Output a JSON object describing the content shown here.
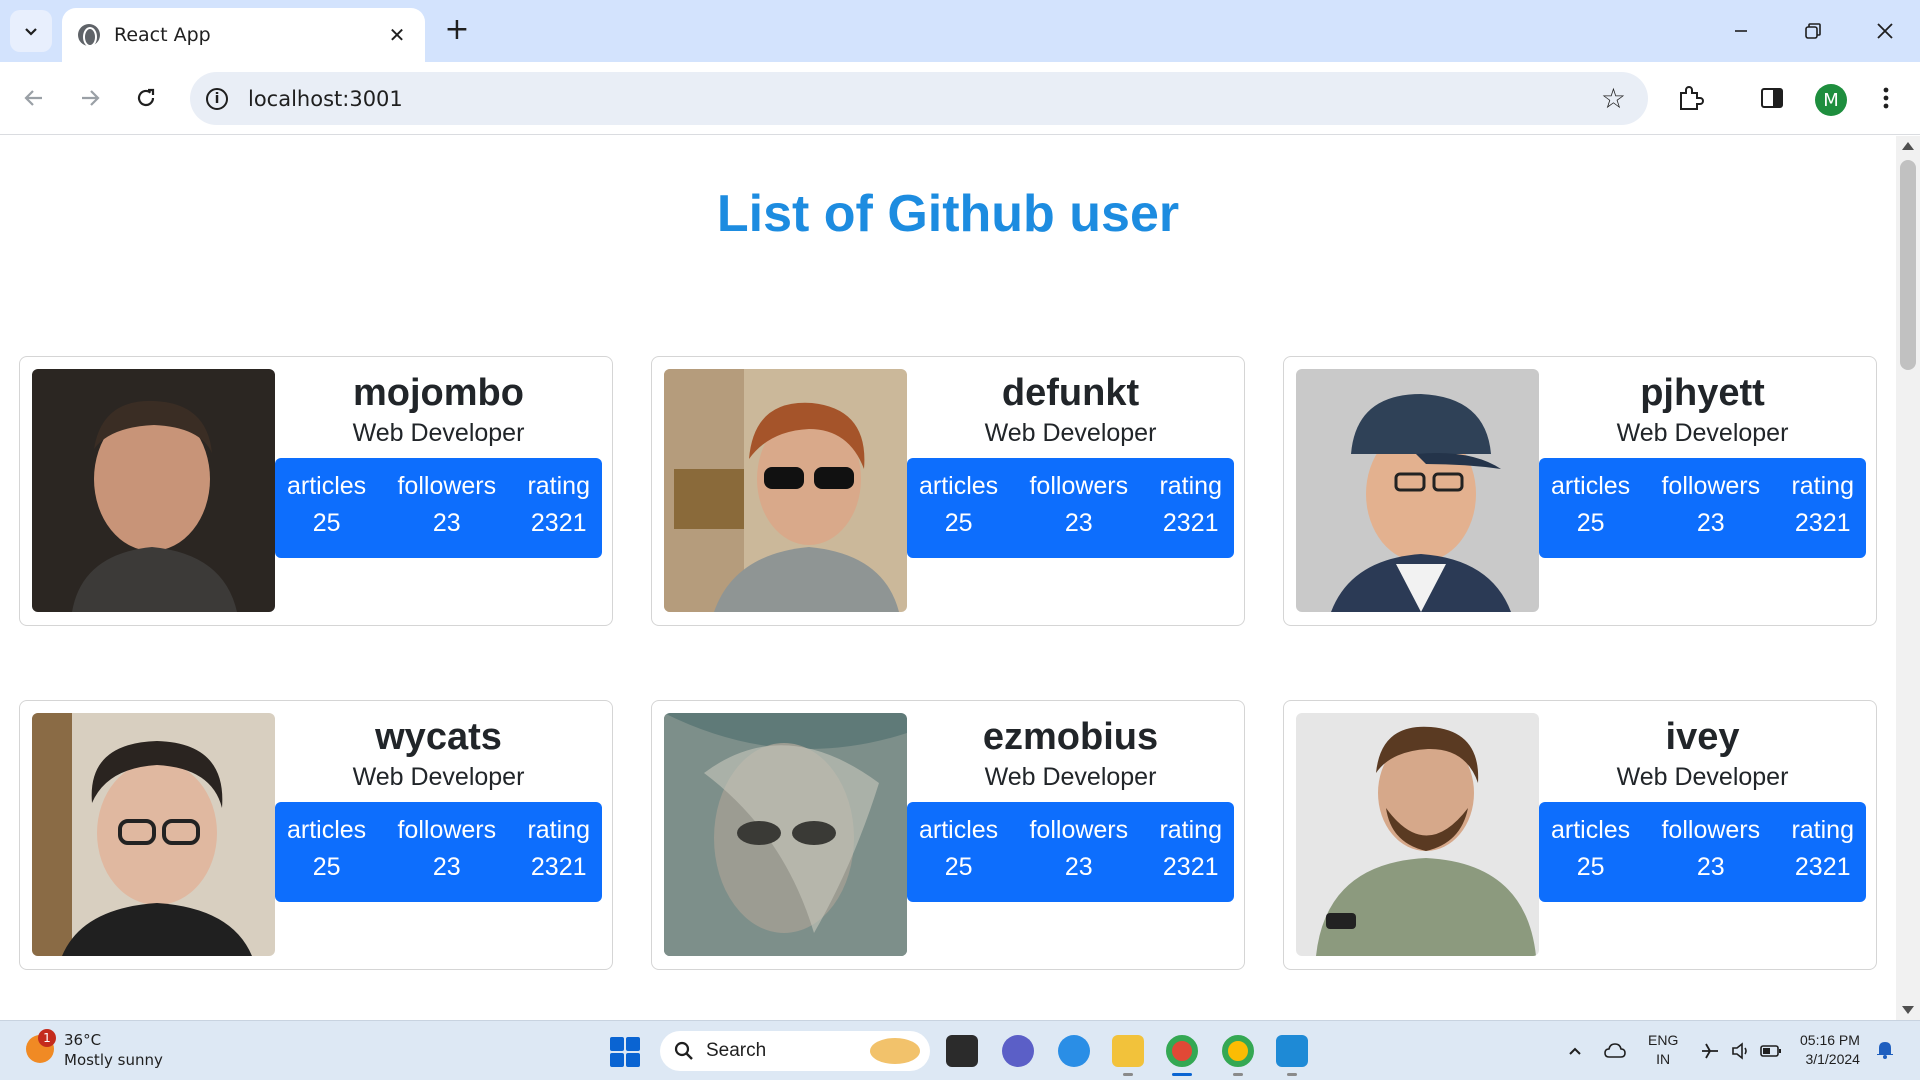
{
  "browser": {
    "tab_title": "React App",
    "url": "localhost:3001",
    "profile_initial": "M"
  },
  "page": {
    "heading": "List of Github user",
    "role": "Web Developer",
    "stat_labels": {
      "articles": "articles",
      "followers": "followers",
      "rating": "rating"
    },
    "users": [
      {
        "login": "mojombo",
        "articles": "25",
        "followers": "23",
        "rating": "2321"
      },
      {
        "login": "defunkt",
        "articles": "25",
        "followers": "23",
        "rating": "2321"
      },
      {
        "login": "pjhyett",
        "articles": "25",
        "followers": "23",
        "rating": "2321"
      },
      {
        "login": "wycats",
        "articles": "25",
        "followers": "23",
        "rating": "2321"
      },
      {
        "login": "ezmobius",
        "articles": "25",
        "followers": "23",
        "rating": "2321"
      },
      {
        "login": "ivey",
        "articles": "25",
        "followers": "23",
        "rating": "2321"
      }
    ]
  },
  "taskbar": {
    "weather_badge": "1",
    "temperature": "36°C",
    "condition": "Mostly sunny",
    "search_label": "Search",
    "lang_line1": "ENG",
    "lang_line2": "IN",
    "time": "05:16 PM",
    "date": "3/1/2024"
  },
  "colors": {
    "heading": "#1d8ce0",
    "stats_bg": "#0d6efd",
    "tab_strip": "#d3e3fd"
  }
}
